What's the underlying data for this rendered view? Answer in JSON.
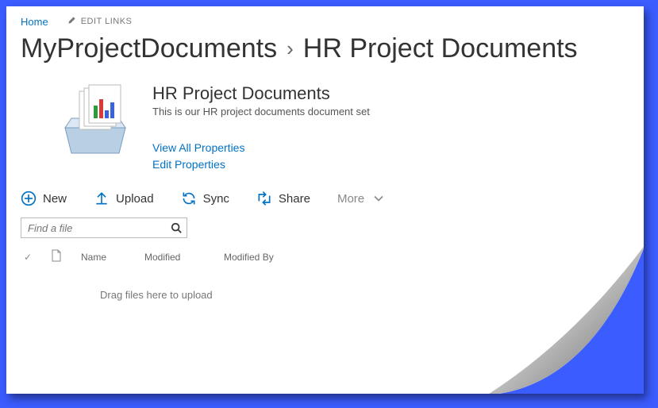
{
  "nav": {
    "home": "Home",
    "edit_links": "EDIT LINKS"
  },
  "breadcrumb": {
    "library": "MyProjectDocuments",
    "current": "HR Project Documents"
  },
  "docset": {
    "title": "HR Project Documents",
    "description": "This is our HR project documents document set",
    "view_all": "View All Properties",
    "edit_props": "Edit Properties"
  },
  "toolbar": {
    "new": "New",
    "upload": "Upload",
    "sync": "Sync",
    "share": "Share",
    "more": "More"
  },
  "search": {
    "placeholder": "Find a file"
  },
  "columns": {
    "name": "Name",
    "modified": "Modified",
    "modified_by": "Modified By"
  },
  "empty_hint": "Drag files here to upload"
}
